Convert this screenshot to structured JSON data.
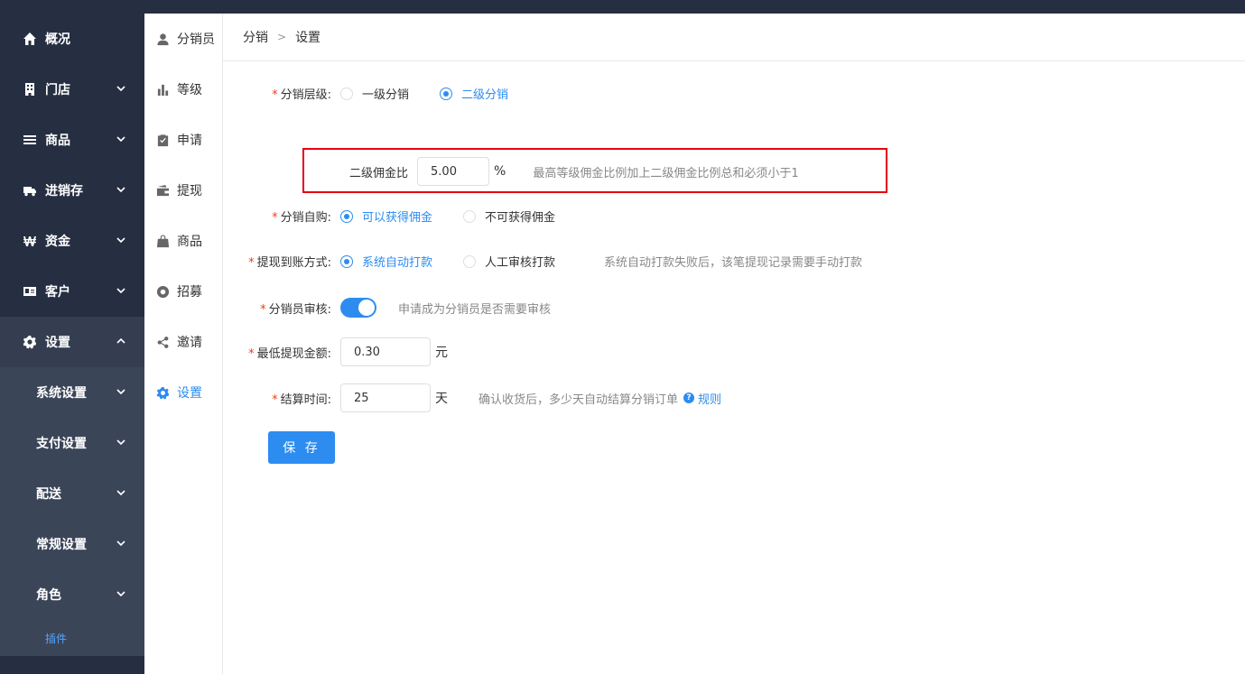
{
  "sidebar": {
    "items": [
      {
        "label": "概况",
        "icon": "home-icon"
      },
      {
        "label": "门店",
        "icon": "building-icon"
      },
      {
        "label": "商品",
        "icon": "list-icon"
      },
      {
        "label": "进销存",
        "icon": "truck-icon"
      },
      {
        "label": "资金",
        "icon": "won-icon"
      },
      {
        "label": "客户",
        "icon": "id-card-icon"
      },
      {
        "label": "设置",
        "icon": "gear-icon"
      }
    ],
    "submenu": [
      {
        "label": "系统设置"
      },
      {
        "label": "支付设置"
      },
      {
        "label": "配送"
      },
      {
        "label": "常规设置"
      },
      {
        "label": "角色"
      },
      {
        "label": "插件"
      }
    ]
  },
  "sidebar2": {
    "items": [
      {
        "label": "分销员",
        "icon": "user-icon"
      },
      {
        "label": "等级",
        "icon": "bar-chart-icon"
      },
      {
        "label": "申请",
        "icon": "clipboard-icon"
      },
      {
        "label": "提现",
        "icon": "wallet-icon"
      },
      {
        "label": "商品",
        "icon": "bag-icon"
      },
      {
        "label": "招募",
        "icon": "lifebuoy-icon"
      },
      {
        "label": "邀请",
        "icon": "share-icon"
      },
      {
        "label": "设置",
        "icon": "gear-icon"
      }
    ]
  },
  "breadcrumb": {
    "parent": "分销",
    "sep": ">",
    "current": "设置"
  },
  "form": {
    "level": {
      "label": "分销层级:",
      "options": [
        "一级分销",
        "二级分销"
      ],
      "selected": "二级分销"
    },
    "commission": {
      "label": "二级佣金比",
      "value": "5.00",
      "unit": "%",
      "hint": "最高等级佣金比例加上二级佣金比例总和必须小于1"
    },
    "self_purchase": {
      "label": "分销自购:",
      "options": [
        "可以获得佣金",
        "不可获得佣金"
      ],
      "selected": "可以获得佣金"
    },
    "withdraw_method": {
      "label": "提现到账方式:",
      "options": [
        "系统自动打款",
        "人工审核打款"
      ],
      "selected": "系统自动打款",
      "hint": "系统自动打款失败后，该笔提现记录需要手动打款"
    },
    "review": {
      "label": "分销员审核:",
      "enabled": true,
      "hint": "申请成为分销员是否需要审核"
    },
    "min_withdraw": {
      "label": "最低提现金额:",
      "value": "0.30",
      "unit": "元"
    },
    "settle_time": {
      "label": "结算时间:",
      "value": "25",
      "unit": "天",
      "hint": "确认收货后，多少天自动结算分销订单",
      "help_mark": "?",
      "link": "规则"
    },
    "save_label": "保 存"
  },
  "colors": {
    "sidebar_bg": "#262f42",
    "accent": "#2d8cf0",
    "highlight_border": "#e60012",
    "required": "#ed4014"
  }
}
